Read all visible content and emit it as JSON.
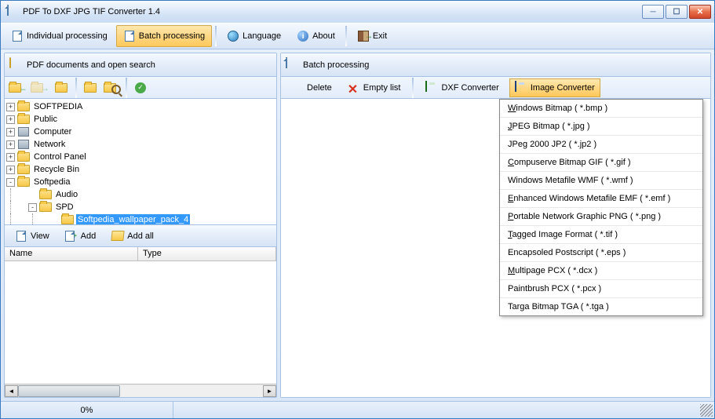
{
  "window": {
    "title": "PDF To DXF JPG TIF Converter 1.4"
  },
  "toolbar": {
    "individual": "Individual processing",
    "batch": "Batch processing",
    "language": "Language",
    "about": "About",
    "exit": "Exit"
  },
  "leftPanel": {
    "header": "PDF documents and open search",
    "midToolbar": {
      "view": "View",
      "add": "Add",
      "addAll": "Add all"
    },
    "listCols": {
      "name": "Name",
      "type": "Type"
    }
  },
  "tree": {
    "items": [
      {
        "indent": 0,
        "toggle": "+",
        "icon": "folder",
        "label": "SOFTPEDIA"
      },
      {
        "indent": 0,
        "toggle": "+",
        "icon": "folder",
        "label": "Public"
      },
      {
        "indent": 0,
        "toggle": "+",
        "icon": "pc",
        "label": "Computer"
      },
      {
        "indent": 0,
        "toggle": "+",
        "icon": "pc",
        "label": "Network"
      },
      {
        "indent": 0,
        "toggle": "+",
        "icon": "folder",
        "label": "Control Panel"
      },
      {
        "indent": 0,
        "toggle": "+",
        "icon": "folder",
        "label": "Recycle Bin"
      },
      {
        "indent": 0,
        "toggle": "-",
        "icon": "folder",
        "label": "Softpedia"
      },
      {
        "indent": 1,
        "toggle": "",
        "icon": "folder",
        "label": "Audio"
      },
      {
        "indent": 1,
        "toggle": "-",
        "icon": "folder",
        "label": "SPD"
      },
      {
        "indent": 2,
        "toggle": "",
        "icon": "folder",
        "label": "Softpedia_wallpaper_pack_4",
        "selected": true
      }
    ]
  },
  "rightPanel": {
    "header": "Batch processing",
    "toolbar": {
      "delete": "Delete",
      "empty": "Empty list",
      "dxf": "DXF Converter",
      "image": "Image Converter"
    }
  },
  "dropdown": [
    {
      "u": "W",
      "text": "indows Bitmap  ( *.bmp )"
    },
    {
      "u": "J",
      "text": "PEG Bitmap  ( *.jpg )"
    },
    {
      "u": "",
      "text": "JPeg 2000 JP2  ( *.jp2 )"
    },
    {
      "u": "C",
      "text": "ompuserve Bitmap GIF  ( *.gif )"
    },
    {
      "u": "",
      "text": "Windows Metafile WMF  ( *.wmf )"
    },
    {
      "u": "E",
      "text": "nhanced Windows Metafile EMF  ( *.emf )"
    },
    {
      "u": "P",
      "text": "ortable Network Graphic PNG   ( *.png )"
    },
    {
      "u": "T",
      "text": "agged Image Format   ( *.tif )"
    },
    {
      "u": "",
      "text": "Encapsoled Postscript  ( *.eps )"
    },
    {
      "u": "M",
      "text": "ultipage PCX ( *.dcx )"
    },
    {
      "u": "",
      "text": "Paintbrush PCX ( *.pcx )"
    },
    {
      "u": "",
      "text": "Targa Bitmap TGA ( *.tga )"
    }
  ],
  "status": {
    "progress": "0%"
  }
}
